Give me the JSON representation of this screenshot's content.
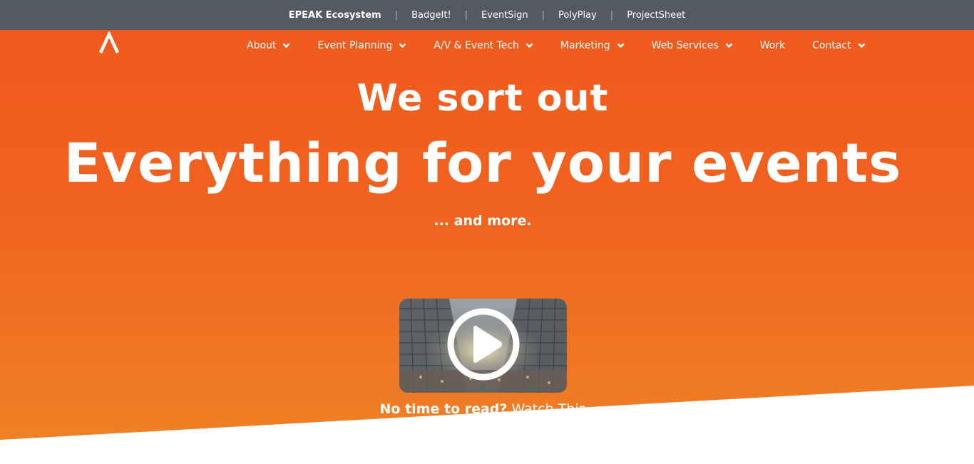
{
  "topbar": {
    "links": [
      {
        "label": "EPEAK Ecosystem"
      },
      {
        "label": "BadgeIt!"
      },
      {
        "label": "EventSign"
      },
      {
        "label": "PolyPlay"
      },
      {
        "label": "ProjectSheet"
      }
    ],
    "separator": "|"
  },
  "logo": {
    "icon": "epeak-logo-icon"
  },
  "nav": {
    "items": [
      {
        "label": "About",
        "dropdown": true
      },
      {
        "label": "Event Planning",
        "dropdown": true
      },
      {
        "label": "A/V & Event Tech",
        "dropdown": true
      },
      {
        "label": "Marketing",
        "dropdown": true
      },
      {
        "label": "Web Services",
        "dropdown": true
      },
      {
        "label": "Work",
        "dropdown": false
      },
      {
        "label": "Contact",
        "dropdown": true
      }
    ]
  },
  "hero": {
    "headline_small": "We sort out",
    "headline_big": "Everything for your events",
    "subline": "... and more.",
    "video": {
      "icon": "play-icon"
    },
    "watch": {
      "lead": "No time to read?",
      "link": "Watch This"
    }
  },
  "colors": {
    "topbar_bg": "#545a63",
    "hero_top": "#f05a1e",
    "hero_bottom": "#ef8426",
    "text": "#ffffff"
  }
}
